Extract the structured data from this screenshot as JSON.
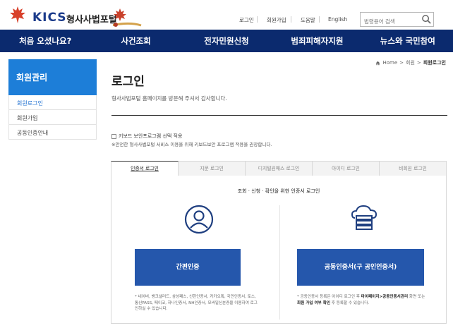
{
  "header": {
    "logo_text": "KICS",
    "logo_sub": "형사사법포털",
    "util_links": [
      "로그인",
      "회원가입",
      "도움말",
      "English"
    ],
    "search_placeholder": "법령용어 검색"
  },
  "gnb": [
    "처음 오셨나요?",
    "사건조회",
    "전자민원신청",
    "범죄피해자지원",
    "뉴스와 국민참여"
  ],
  "sidebar": {
    "title": "회원관리",
    "items": [
      "회원로그인",
      "회원가입",
      "공동인증안내"
    ]
  },
  "breadcrumb": {
    "home": "Home",
    "level1": "회원",
    "current": "회원로그인"
  },
  "page": {
    "title": "로그인",
    "description": "형사사법포털 홈페이지를 방문해 주셔서 감사합니다.",
    "keyboard_check_label": "키보드 보안프로그램 선택 적용",
    "keyboard_note": "※안전한 형사사법포털 서비스 이용을 위해 키보드보안 프로그램 적용을 권장합니다."
  },
  "tabs": [
    "인증서 로그인",
    "지문 로그인",
    "디지털원패스 로그인",
    "아이디 로그인",
    "비회원 로그인"
  ],
  "panel": {
    "heading": "조회 · 신청 · 확인을 위한 인증서 로그인",
    "left_button": "간편인증",
    "right_button": "공동인증서(구 공인인증서)",
    "left_note": "네이버, 뱅크샐러드, 삼성패스, 신한인증서, 카카오톡, 국민인증서, 토스, 통신PASS, 페이코, 하나인증서, NH인증서, 모바일신분증을 이용하여 로그인하실 수 있습니다.",
    "right_note_1": "공동인증서 등록은 아이디 로그인 후",
    "right_note_bold_1": "마이페이지>공동인증서관리",
    "right_note_2": "화면 또는",
    "right_note_bold_2": "회원 가입 여부 확인",
    "right_note_3": "후 등록할 수 있습니다."
  },
  "colors": {
    "navy": "#0b2a6e",
    "blue": "#2557ac",
    "sidebar_blue": "#1d7ed8"
  }
}
